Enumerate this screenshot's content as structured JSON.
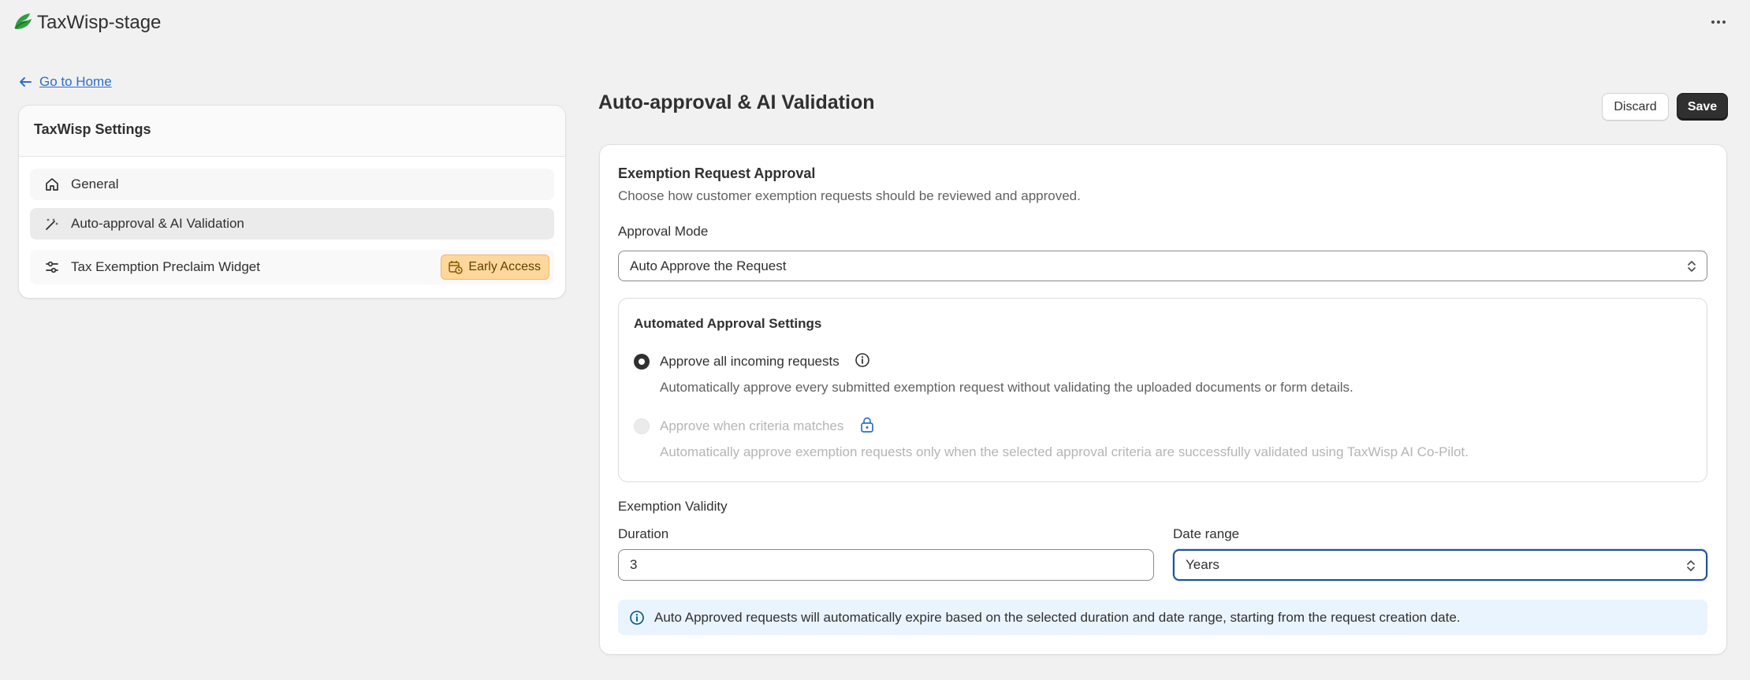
{
  "app": {
    "title": "TaxWisp-stage"
  },
  "nav": {
    "back_label": "Go to Home"
  },
  "sidebar": {
    "title": "TaxWisp Settings",
    "items": [
      {
        "label": "General",
        "icon": "home-icon"
      },
      {
        "label": "Auto-approval & AI Validation",
        "icon": "magic-wand-icon",
        "active": true
      },
      {
        "label": "Tax Exemption Preclaim Widget",
        "icon": "sliders-icon",
        "badge": "Early Access"
      }
    ]
  },
  "page": {
    "title": "Auto-approval & AI Validation",
    "discard_label": "Discard",
    "save_label": "Save"
  },
  "exemption_request": {
    "title": "Exemption Request Approval",
    "description": "Choose how customer exemption requests should be reviewed and approved.",
    "approval_mode_label": "Approval Mode",
    "approval_mode_value": "Auto Approve the Request"
  },
  "automated_settings": {
    "title": "Automated Approval Settings",
    "options": [
      {
        "label": "Approve all incoming requests",
        "description": "Automatically approve every submitted exemption request without validating the uploaded documents or form details.",
        "selected": true,
        "disabled": false
      },
      {
        "label": "Approve when criteria matches",
        "description": "Automatically approve exemption requests only when the selected approval criteria are successfully validated using TaxWisp AI Co-Pilot.",
        "selected": false,
        "disabled": true
      }
    ]
  },
  "validity": {
    "title": "Exemption Validity",
    "duration_label": "Duration",
    "duration_value": "3",
    "date_range_label": "Date range",
    "date_range_value": "Years",
    "info_text": "Auto Approved requests will automatically expire based on the selected duration and date range, starting from the request creation date."
  },
  "colors": {
    "background": "#f1f1f1",
    "primary_button": "#303030",
    "link": "#2c6ecb",
    "badge": "#ffd79d",
    "info_banner": "#eaf4ff",
    "focus_ring": "#1f5199",
    "logo_green": "#2e9e3e"
  }
}
